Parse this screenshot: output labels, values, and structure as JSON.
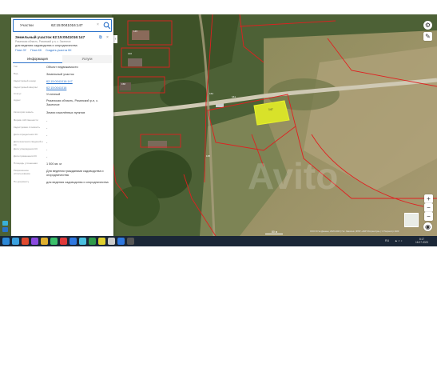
{
  "search": {
    "type_label": "Участки",
    "query": "62:15:0041016:147"
  },
  "card": {
    "title": "Земельный участок 62:15:0041016:147",
    "subtitle": "Рязанская область, Рязанский р-н, с. Засечное",
    "use": "для ведения садоводства и огородничества",
    "links": [
      "План ЗУ",
      "План КК",
      "Создать участок КК"
    ],
    "tabs": [
      "Информация",
      "Услуги"
    ],
    "active_tab": 0
  },
  "rows": [
    {
      "label": "Тип",
      "value": "Объект недвижимости"
    },
    {
      "label": "Вид",
      "value": "Земельный участок"
    },
    {
      "label": "Кадастровый номер",
      "value": "62:15:0041016:147",
      "link": true
    },
    {
      "label": "Кадастровый квартал",
      "value": "62:15:0041016",
      "link": true
    },
    {
      "label": "Статус",
      "value": "Учтенный"
    },
    {
      "label": "Адрес",
      "value": "Рязанская область, Рязанский р-н, с. Засечное"
    },
    {
      "label": "Категория земель",
      "value": "Земли населённых пунктов"
    },
    {
      "label": "Форма собственности",
      "value": "-"
    },
    {
      "label": "Кадастровая стоимость",
      "value": "-"
    },
    {
      "label": "Дата определения КС",
      "value": "-"
    },
    {
      "label": "Дата внесения сведений о КС",
      "value": "-"
    },
    {
      "label": "Дата утверждения КС",
      "value": "-"
    },
    {
      "label": "Дата применения КС",
      "value": "-"
    },
    {
      "label": "Площадь уточненная",
      "value": "1 500 кв. м"
    },
    {
      "label": "Разрешенное использование",
      "value": "Для ведения гражданами садоводства и огородничества"
    },
    {
      "label": "По документу",
      "value": "для ведения садоводства и огородничества"
    }
  ],
  "map": {
    "scale": "80 м",
    "copyright": "ООО Ф Гео Данные, 2020-2023 | Гос. Заказчик, ФГБУ «ФКП Росреестра» | © Росреестр 2023",
    "parcel_label": "147"
  },
  "taskbar": {
    "lang": "RU",
    "time": "8:17",
    "date": "16.07.2023",
    "icon_colors": [
      "#3aa1e0",
      "#e04a2f",
      "#8a4ae0",
      "#e0b02f",
      "#3ac06a",
      "#e03a3a",
      "#2f78e0",
      "#4ac0e0",
      "#2f9a4a",
      "#e0d02f",
      "#ccc",
      "#2f78e0",
      "#555"
    ]
  },
  "colors": {
    "accent": "#2b72c9",
    "parcel_fill": "#d8e22a",
    "boundary": "#e02020"
  }
}
